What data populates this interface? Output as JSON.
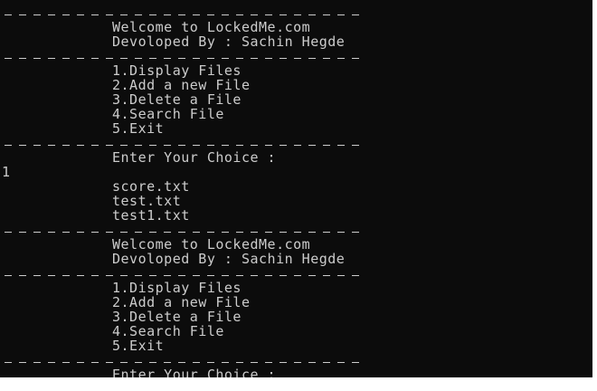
{
  "console": {
    "lines": [
      {
        "kind": "sep"
      },
      {
        "kind": "ind",
        "text": "Welcome to LockedMe.com"
      },
      {
        "kind": "ind",
        "text": "Devoloped By : Sachin Hegde"
      },
      {
        "kind": "sep"
      },
      {
        "kind": "ind",
        "text": "1.Display Files"
      },
      {
        "kind": "ind",
        "text": "2.Add a new File"
      },
      {
        "kind": "ind",
        "text": "3.Delete a File"
      },
      {
        "kind": "ind",
        "text": "4.Search File"
      },
      {
        "kind": "ind",
        "text": "5.Exit"
      },
      {
        "kind": "sep"
      },
      {
        "kind": "ind",
        "text": "Enter Your Choice :"
      },
      {
        "kind": "raw",
        "text": "1"
      },
      {
        "kind": "ind",
        "text": "score.txt"
      },
      {
        "kind": "ind",
        "text": "test.txt"
      },
      {
        "kind": "ind",
        "text": "test1.txt"
      },
      {
        "kind": "sep"
      },
      {
        "kind": "ind",
        "text": "Welcome to LockedMe.com"
      },
      {
        "kind": "ind",
        "text": "Devoloped By : Sachin Hegde"
      },
      {
        "kind": "sep"
      },
      {
        "kind": "ind",
        "text": "1.Display Files"
      },
      {
        "kind": "ind",
        "text": "2.Add a new File"
      },
      {
        "kind": "ind",
        "text": "3.Delete a File"
      },
      {
        "kind": "ind",
        "text": "4.Search File"
      },
      {
        "kind": "ind",
        "text": "5.Exit"
      },
      {
        "kind": "sep"
      },
      {
        "kind": "ind",
        "text": "Enter Your Choice :"
      }
    ]
  }
}
